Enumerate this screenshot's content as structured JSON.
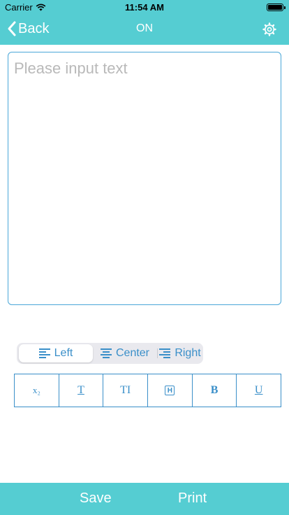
{
  "status_bar": {
    "carrier": "Carrier",
    "time": "11:54 AM"
  },
  "nav": {
    "back_label": "Back",
    "title": "ON"
  },
  "editor": {
    "placeholder": "Please input text",
    "value": ""
  },
  "alignment": {
    "options": [
      "Left",
      "Center",
      "Right"
    ],
    "selected": "Left"
  },
  "style_buttons": [
    "x₂",
    "T",
    "TI",
    "H",
    "B",
    "U"
  ],
  "bottom_bar": {
    "save_label": "Save",
    "print_label": "Print"
  },
  "colors": {
    "accent": "#55cdd2",
    "control_blue": "#3a8fc9",
    "border_blue": "#4aa7d8",
    "placeholder": "#b9b9b9"
  }
}
